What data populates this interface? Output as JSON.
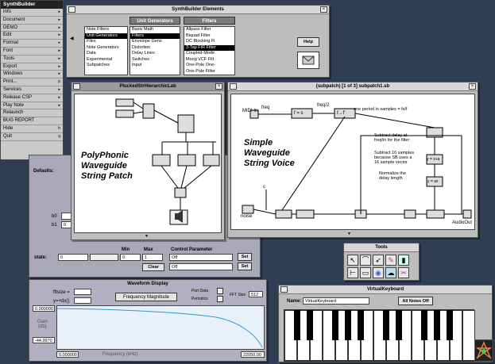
{
  "menu": {
    "title": "SynthBuilder",
    "items": [
      {
        "label": "Info",
        "arrow": "▸"
      },
      {
        "label": "Document",
        "arrow": "▸"
      },
      {
        "label": "DEMO",
        "arrow": "▸"
      },
      {
        "label": "Edit",
        "arrow": "▸"
      },
      {
        "label": "Format",
        "arrow": "▸"
      },
      {
        "label": "Font",
        "arrow": "▸"
      },
      {
        "label": "Tools",
        "arrow": "▸"
      },
      {
        "label": "Export",
        "arrow": "▸"
      },
      {
        "label": "Windows",
        "arrow": "▸"
      },
      {
        "label": "Print...",
        "arrow": "p"
      },
      {
        "label": "Services",
        "arrow": "▸"
      },
      {
        "label": "Release CSP",
        "arrow": "▸"
      },
      {
        "label": "Play Note",
        "arrow": "▸"
      },
      {
        "label": "Relaunch",
        "arrow": ""
      },
      {
        "label": "BUG REPORT",
        "arrow": ""
      },
      {
        "label": "Hide",
        "arrow": "h"
      },
      {
        "label": "Quit",
        "arrow": "q"
      }
    ]
  },
  "elements_window": {
    "title": "SynthBuilder Elements",
    "col1": [
      "Note Filters",
      "Unit Generators",
      "Files",
      "Note Generators",
      "Data",
      "Experimental",
      "Subpatches"
    ],
    "col2_header": "Unit Generators",
    "col2": [
      "Basic Math",
      "Filters",
      "Envelope Gens",
      "Distortion",
      "Delay Lines",
      "Switches",
      "Input"
    ],
    "col3_header": "Filters",
    "col3": [
      "Allpass Filter",
      "Biquad Filter",
      "DC Blocking Fi",
      "3-Tap FIR Filter",
      "Coupled-Mode",
      "Moog VCF Filt",
      "One-Pole One-",
      "One-Pole Filter"
    ],
    "selected": {
      "col1": 1,
      "col2": 1,
      "col3": 3
    },
    "help_label": "Help"
  },
  "patch_window": {
    "title": "PluckedStrHierarchicLab",
    "text": "PolyPhonic\nWaveguide\nString Patch"
  },
  "subpatch_window": {
    "title": "(subpatch) [1 of 3]  subpatch1.sb",
    "text": "Simple\nWaveguide\nString Voice",
    "labels": {
      "midi_in": "MIDI In",
      "freq": "freq",
      "freq2": "freq/2",
      "one_period": "one period in samples = fs/f",
      "subtract": "Subtract delay at\nfreq/in for the filter",
      "subtract2": "Subtract 16 samples\nbecause SB uses a\n16 sample vector",
      "normalize": "Normalize the\ndelay length",
      "noise": "noise",
      "audio_out": "AudioOut",
      "c_label": "c",
      "fx1": "f = s",
      "fx2": "f→f'",
      "fx3": "y = x+a",
      "fx4": "y = ax"
    }
  },
  "inspector": {
    "defaults_label": "Defaults:",
    "b0": "b0",
    "b1": "b1",
    "b1_val": "0",
    "state_label": "state:",
    "state_val": "0",
    "min_label": "Min",
    "max_label": "Max",
    "min_val": "0",
    "max_val": "1",
    "control_param_label": "Control Parameter",
    "cp1": "Off",
    "cp2": "Off",
    "clear_label": "Clear",
    "set_label": "Set"
  },
  "waveform": {
    "title": "Waveform Display",
    "fftsize_label": "fftsize =",
    "yref_label": "y=+dx()",
    "popup": "Frequency Magnitude",
    "portdata_label": "Port Data",
    "periodics_label": "Periodics",
    "fft_label": "FFT Size",
    "fft_val": "512",
    "y_top": "0.000000",
    "y_axis": "Gain\n(db)",
    "y_bottom": "-44.9970",
    "x_left": "0.000000",
    "x_label": "Frequency (kHz)",
    "x_right": "22050.00"
  },
  "tools_window": {
    "title": "Tools"
  },
  "keyboard": {
    "title": "VirtualKeyboard",
    "name_label": "Name:",
    "name_val": "VirtualKeyboard",
    "all_notes_off": "All Notes Off"
  },
  "colors": {
    "desktop": "#2f3e52",
    "panel": "#bdbdbd",
    "waveform_curve": "#3399cc"
  }
}
